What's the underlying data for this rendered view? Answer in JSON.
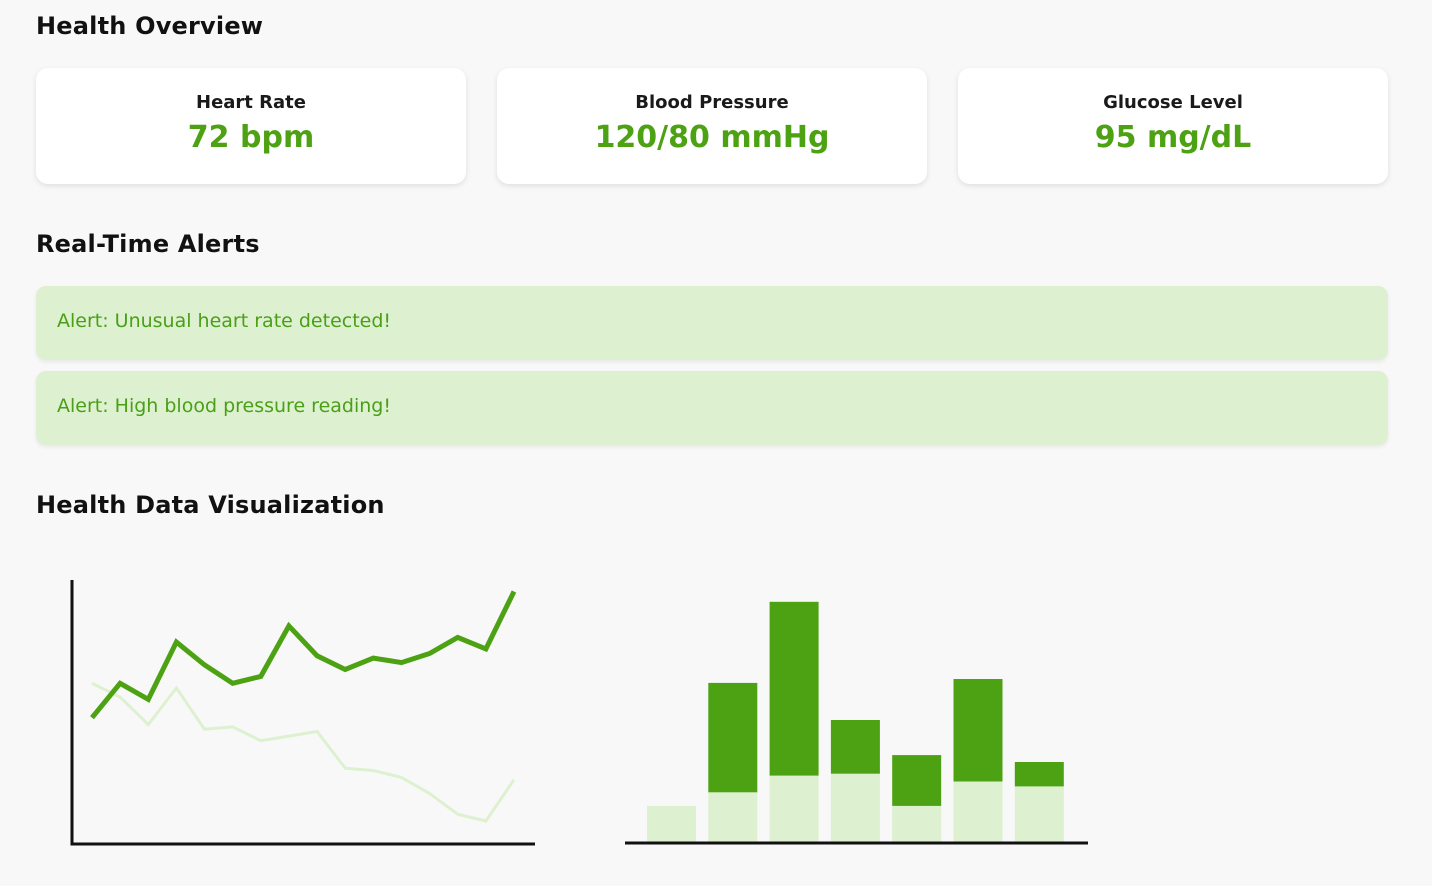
{
  "overview": {
    "title": "Health Overview",
    "cards": [
      {
        "label": "Heart Rate",
        "value": "72 bpm"
      },
      {
        "label": "Blood Pressure",
        "value": "120/80 mmHg"
      },
      {
        "label": "Glucose Level",
        "value": "95 mg/dL"
      }
    ]
  },
  "alerts": {
    "title": "Real-Time Alerts",
    "items": [
      {
        "text": "Alert: Unusual heart rate detected!"
      },
      {
        "text": "Alert: High blood pressure reading!"
      }
    ]
  },
  "visualization": {
    "title": "Health Data Visualization"
  },
  "colors": {
    "accent": "#4ca212",
    "accent_light": "#ddf1d0",
    "background": "#f8f8f8",
    "card": "#ffffff"
  },
  "chart_data": [
    {
      "type": "line",
      "x": [
        1,
        2,
        3,
        4,
        5,
        6,
        7,
        8,
        9,
        10,
        11,
        12,
        13,
        14,
        15,
        16
      ],
      "series": [
        {
          "values": [
            45,
            60,
            53,
            78,
            68,
            60,
            63,
            85,
            72,
            66,
            71,
            69,
            73,
            80,
            75,
            100
          ],
          "color": "#4ca212"
        },
        {
          "values": [
            60,
            54,
            42,
            58,
            40,
            41,
            35,
            37,
            39,
            23,
            22,
            19,
            12,
            3,
            0,
            18
          ],
          "color": "#ddf1d0"
        }
      ],
      "ylim": [
        -10,
        105
      ]
    },
    {
      "type": "bar",
      "stacked": true,
      "categories": [
        "1",
        "2",
        "3",
        "4",
        "5",
        "6",
        "7"
      ],
      "series": [
        {
          "values": [
            38,
            52,
            69,
            71,
            38,
            63,
            58
          ],
          "color": "#ddf1d0"
        },
        {
          "values": [
            0,
            112,
            178,
            55,
            52,
            105,
            25
          ],
          "color": "#4ca212"
        }
      ],
      "ylim": [
        0,
        255
      ]
    }
  ]
}
